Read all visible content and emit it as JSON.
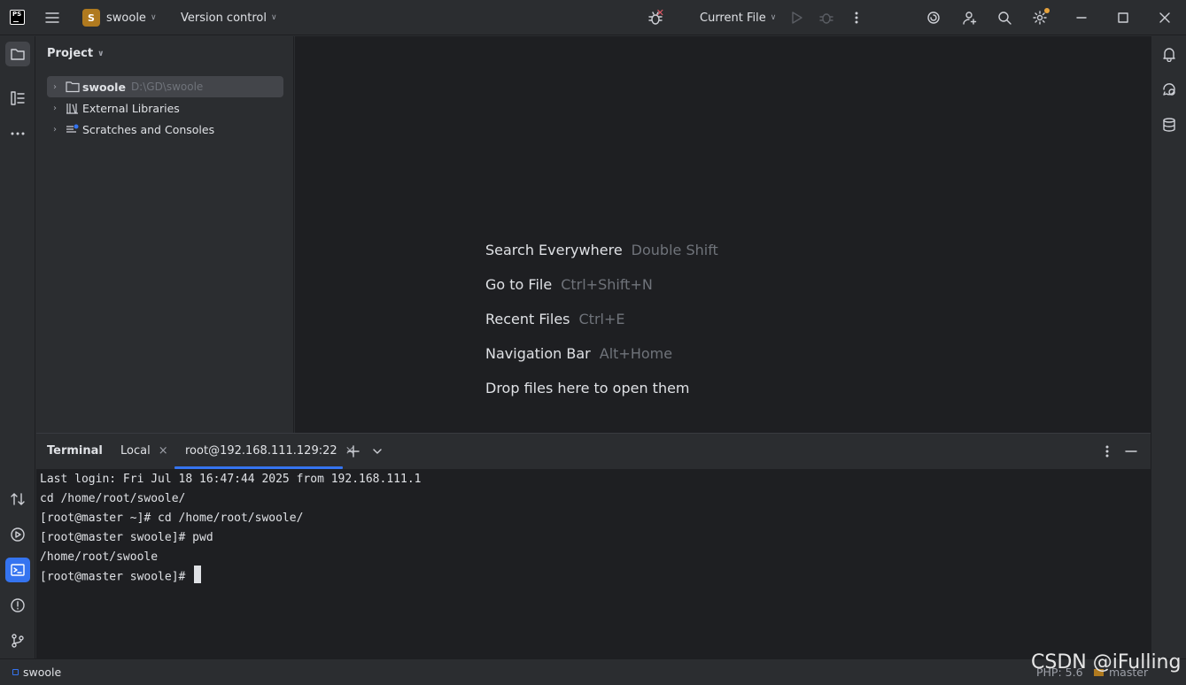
{
  "titlebar": {
    "logo_text": "PS",
    "project_badge": "S",
    "project_name": "swoole",
    "vcs_label": "Version control",
    "run_config": "Current File"
  },
  "project_panel": {
    "title": "Project",
    "tree": [
      {
        "label": "swoole",
        "path": "D:\\GD\\swoole",
        "icon": "folder-icon"
      },
      {
        "label": "External Libraries",
        "icon": "library-icon"
      },
      {
        "label": "Scratches and Consoles",
        "icon": "scratches-icon"
      }
    ]
  },
  "editor": {
    "hints": [
      {
        "action": "Search Everywhere",
        "shortcut": "Double Shift"
      },
      {
        "action": "Go to File",
        "shortcut": "Ctrl+Shift+N"
      },
      {
        "action": "Recent Files",
        "shortcut": "Ctrl+E"
      },
      {
        "action": "Navigation Bar",
        "shortcut": "Alt+Home"
      },
      {
        "action": "Drop files here to open them",
        "shortcut": ""
      }
    ]
  },
  "terminal": {
    "title": "Terminal",
    "tabs": [
      {
        "label": "Local"
      },
      {
        "label": "root@192.168.111.129:22"
      }
    ],
    "lines": [
      "Last login: Fri Jul 18 16:47:44 2025 from 192.168.111.1",
      "cd /home/root/swoole/",
      "[root@master ~]# cd /home/root/swoole/",
      "[root@master swoole]# pwd",
      "/home/root/swoole",
      "[root@master swoole]# "
    ]
  },
  "statusbar": {
    "project": "swoole",
    "php_version": "PHP: 5.6",
    "branch": "master"
  },
  "watermark": "CSDN @iFulling",
  "colors": {
    "accent": "#3574f0",
    "badge": "#b07a1f",
    "panel_bg": "#2b2d30",
    "editor_bg": "#1e1f22"
  }
}
